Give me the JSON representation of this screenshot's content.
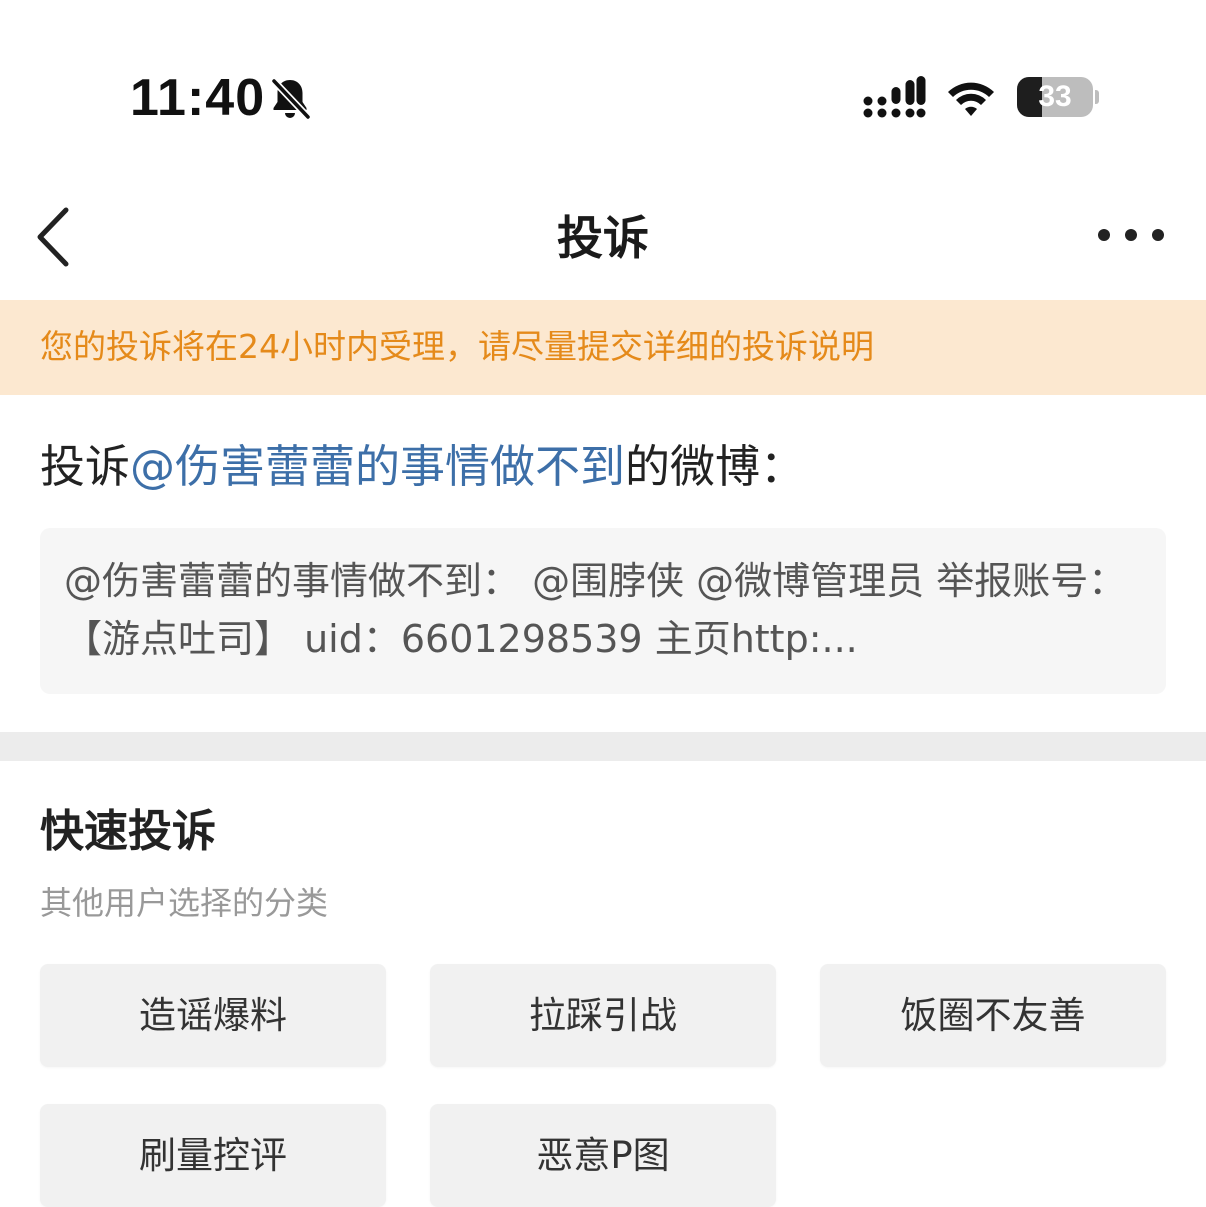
{
  "status_bar": {
    "time": "11:40",
    "battery_level": "33",
    "battery_fraction": 0.33,
    "icons": [
      "bell-slash-icon",
      "signal-icon",
      "wifi-icon",
      "battery-icon"
    ]
  },
  "nav": {
    "title": "投诉",
    "back_icon": "chevron-left-icon",
    "more_icon": "ellipsis-icon"
  },
  "notice": {
    "text": "您的投诉将在24小时内受理，请尽量提交详细的投诉说明"
  },
  "target": {
    "prefix": "投诉",
    "user": "@伤害蕾蕾的事情做不到",
    "suffix": "的微博："
  },
  "post_preview": {
    "text": "@伤害蕾蕾的事情做不到：  @围脖侠 @微博管理员 举报账号：【游点吐司】 uid：6601298539 主页http:..."
  },
  "quick_complaint": {
    "title": "快速投诉",
    "subtitle": "其他用户选择的分类",
    "categories": [
      {
        "label": "造谣爆料"
      },
      {
        "label": "拉踩引战"
      },
      {
        "label": "饭圈不友善"
      },
      {
        "label": "刷量控评"
      },
      {
        "label": "恶意P图"
      }
    ]
  },
  "colors": {
    "notice_background": "#fce8d0",
    "notice_text": "#e58a1a",
    "link_blue": "#3d6fa8",
    "divider": "#ececec",
    "button_background": "#f1f1f1"
  }
}
